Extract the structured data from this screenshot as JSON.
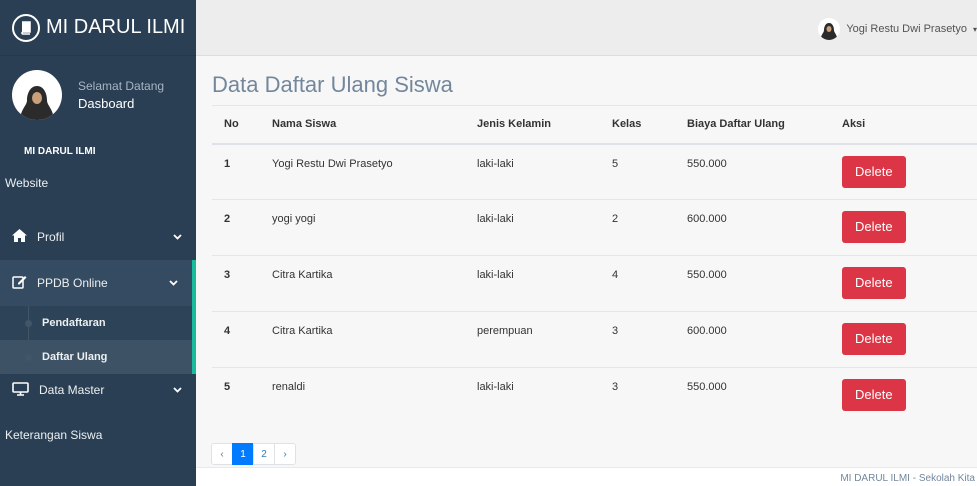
{
  "app": {
    "title": "MI DARUL ILMI"
  },
  "sidebar": {
    "welcome": "Selamat Datang",
    "profile_name": "Dasboard",
    "section_title": "MI DARUL ILMI",
    "website": "Website",
    "menu": {
      "profil": "Profil",
      "ppdb": "PPDB Online",
      "ppdb_sub": [
        "Pendaftaran",
        "Daftar Ulang"
      ],
      "data_master": "Data Master"
    },
    "keterangan": "Keterangan Siswa"
  },
  "topbar": {
    "user": "Yogi Restu Dwi Prasetyo"
  },
  "main": {
    "title": "Data Daftar Ulang Siswa",
    "columns": [
      "No",
      "Nama Siswa",
      "Jenis Kelamin",
      "Kelas",
      "Biaya Daftar Ulang",
      "Aksi"
    ],
    "rows": [
      {
        "no": "1",
        "nama": "Yogi Restu Dwi Prasetyo",
        "jk": "laki-laki",
        "kelas": "5",
        "biaya": "550.000",
        "aksi": "Delete"
      },
      {
        "no": "2",
        "nama": "yogi yogi",
        "jk": "laki-laki",
        "kelas": "2",
        "biaya": "600.000",
        "aksi": "Delete"
      },
      {
        "no": "3",
        "nama": "Citra Kartika",
        "jk": "laki-laki",
        "kelas": "4",
        "biaya": "550.000",
        "aksi": "Delete"
      },
      {
        "no": "4",
        "nama": "Citra Kartika",
        "jk": "perempuan",
        "kelas": "3",
        "biaya": "600.000",
        "aksi": "Delete"
      },
      {
        "no": "5",
        "nama": "renaldi",
        "jk": "laki-laki",
        "kelas": "3",
        "biaya": "550.000",
        "aksi": "Delete"
      }
    ],
    "pagination": {
      "prev": "‹",
      "pages": [
        "1",
        "2"
      ],
      "next": "›",
      "current": "1"
    }
  },
  "footer": {
    "text": "MI DARUL ILMI - Sekolah Kita"
  },
  "colors": {
    "sidebar": "#2a3f54",
    "accent": "#1abb9c",
    "danger": "#dc3545",
    "primary": "#007bff"
  },
  "icons": [
    "book-icon",
    "home-icon",
    "edit-icon",
    "monitor-icon",
    "chevron-down-icon",
    "user-avatar-icon"
  ]
}
